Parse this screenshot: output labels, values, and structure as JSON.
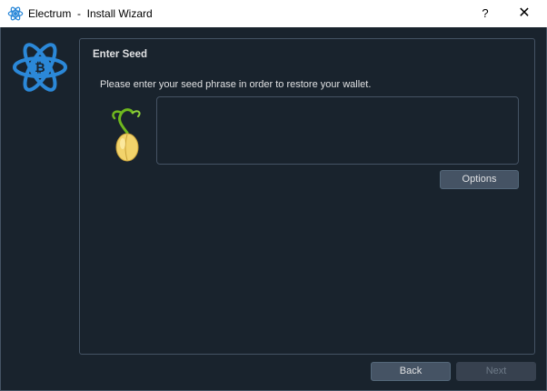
{
  "window": {
    "title": "Electrum  -  Install Wizard",
    "help_label": "?",
    "close_label": "✕"
  },
  "page": {
    "heading": "Enter Seed",
    "message": "Please enter your seed phrase in order to restore your wallet.",
    "seed_input": {
      "value": "",
      "placeholder": ""
    },
    "options_label": "Options"
  },
  "footer": {
    "back_label": "Back",
    "next_label": "Next",
    "next_enabled": false
  },
  "colors": {
    "background": "#19232d",
    "border": "#455364",
    "button": "#455364",
    "text": "#e0e1e3",
    "logo_blue": "#2b88d8"
  },
  "icons": [
    "electrum-app-icon",
    "electrum-logo-icon",
    "seed-sprout-icon",
    "help-icon",
    "close-icon"
  ]
}
